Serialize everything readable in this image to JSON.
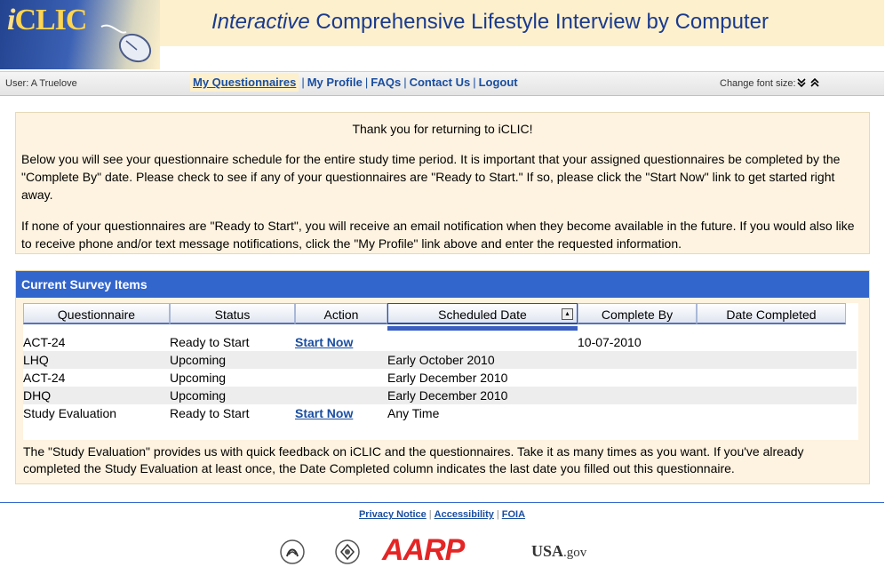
{
  "header": {
    "logo_i": "i",
    "logo_rest": "CLIC",
    "title_italic": "Interactive",
    "title_rest": " Comprehensive Lifestyle Interview by Computer"
  },
  "nav": {
    "user": "User: A Truelove",
    "links": [
      "My Questionnaires",
      "My Profile",
      "FAQs",
      "Contact Us",
      "Logout"
    ],
    "active": "My Questionnaires",
    "font_size_label": "Change font size:"
  },
  "intro": {
    "thanks": "Thank you for returning to iCLIC!",
    "p1": "Below you will see your questionnaire schedule for the entire study time period. It is important that your assigned questionnaires be completed by the \"Complete By\" date. Please check to see if any of your questionnaires are \"Ready to Start.\" If so, please click the \"Start Now\" link to get started right away.",
    "p2": "If none of your questionnaires are \"Ready to Start\", you will receive an email notification when they become available in the future. If you would also like to receive phone and/or text message notifications, click the \"My Profile\" link above and enter the requested information."
  },
  "survey": {
    "heading": "Current Survey Items",
    "columns": [
      "Questionnaire",
      "Status",
      "Action",
      "Scheduled Date",
      "Complete By",
      "Date Completed"
    ],
    "sorted_column": "Scheduled Date",
    "rows": [
      {
        "questionnaire": "ACT-24",
        "status": "Ready to Start",
        "action": "Start Now",
        "scheduled": "",
        "complete_by": "10-07-2010",
        "date_completed": ""
      },
      {
        "questionnaire": "LHQ",
        "status": "Upcoming",
        "action": "",
        "scheduled": "Early October 2010",
        "complete_by": "",
        "date_completed": ""
      },
      {
        "questionnaire": "ACT-24",
        "status": "Upcoming",
        "action": "",
        "scheduled": "Early December 2010",
        "complete_by": "",
        "date_completed": ""
      },
      {
        "questionnaire": "DHQ",
        "status": "Upcoming",
        "action": "",
        "scheduled": "Early December 2010",
        "complete_by": "",
        "date_completed": ""
      },
      {
        "questionnaire": "Study Evaluation",
        "status": "Ready to Start",
        "action": "Start Now",
        "scheduled": "Any Time",
        "complete_by": "",
        "date_completed": ""
      }
    ],
    "note": "The \"Study Evaluation\" provides us with quick feedback on iCLIC and the questionnaires. Take it as many times as you want. If you've already completed the Study Evaluation at least once, the Date Completed column indicates the last date you filled out this questionnaire."
  },
  "footer": {
    "links": [
      "Privacy Notice",
      "Accessibility",
      "FOIA"
    ],
    "aarp": "AARP",
    "usa": "USA",
    "gov": ".gov"
  },
  "colors": {
    "accent": "#3366cc",
    "panel": "#fef3e0",
    "banner": "#fdf0cc",
    "link": "#1a4ea0",
    "aarp_red": "#e42525"
  },
  "icons": [
    "mouse-icon",
    "chevron-down-double-icon",
    "chevron-up-double-icon",
    "sort-toggle-icon",
    "hhs-logo",
    "nih-logo"
  ]
}
